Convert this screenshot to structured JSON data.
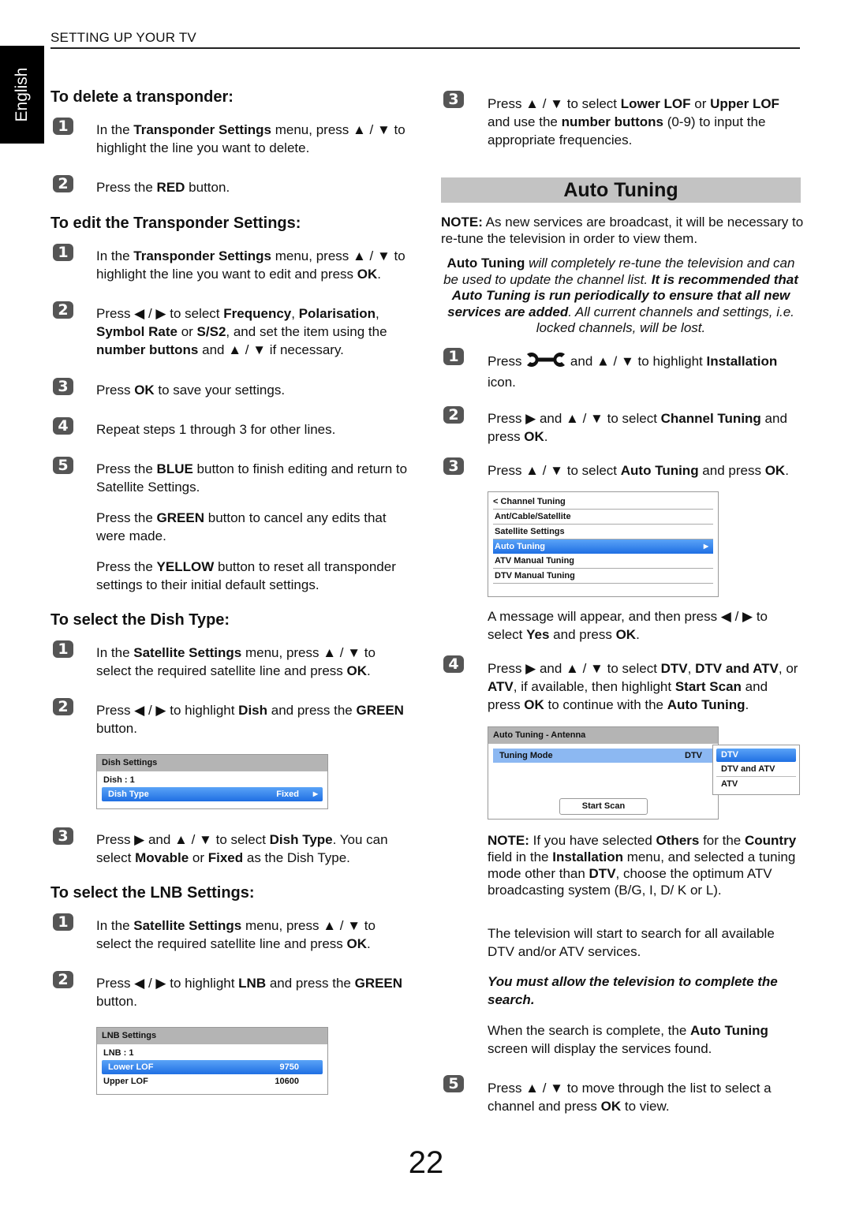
{
  "header": {
    "section": "SETTING UP YOUR TV",
    "language_tab": "English",
    "page_number": "22"
  },
  "left": {
    "delete": {
      "title": "To delete a transponder:",
      "steps": [
        {
          "n": "1",
          "pre": "In the ",
          "b1": "Transponder Settings",
          "mid": " menu, press ▲ / ▼ to highlight the line you want to delete."
        },
        {
          "n": "2",
          "pre": "Press the ",
          "b1": "RED",
          "mid": " button."
        }
      ]
    },
    "edit": {
      "title": "To edit the Transponder Settings:",
      "s1": {
        "n": "1",
        "a": "In the ",
        "b": "Transponder Settings",
        "c": " menu, press ▲ / ▼ to highlight the line you want to edit and press ",
        "d": "OK",
        "e": "."
      },
      "s2": {
        "n": "2",
        "a": "Press ◀ / ▶ to select ",
        "b": "Frequency",
        "c": ", ",
        "d": "Polarisation",
        "e": ", ",
        "f": "Symbol Rate",
        "g": " or ",
        "h": "S/S2",
        "i": ", and set the item using the ",
        "j": "number buttons",
        "k": " and ▲ / ▼ if necessary."
      },
      "s3": {
        "n": "3",
        "a": "Press ",
        "b": "OK",
        "c": " to save your settings."
      },
      "s4": {
        "n": "4",
        "a": "Repeat steps 1 through 3 for other lines."
      },
      "s5": {
        "n": "5",
        "a": "Press the ",
        "b": "BLUE",
        "c": " button to finish editing and return to Satellite Settings."
      },
      "p_green": {
        "a": "Press the ",
        "b": "GREEN",
        "c": " button to cancel any edits that were made."
      },
      "p_yellow": {
        "a": "Press the ",
        "b": "YELLOW",
        "c": " button to reset all transponder settings to their initial default settings."
      }
    },
    "dish": {
      "title": "To select the Dish Type:",
      "s1": {
        "n": "1",
        "a": "In the ",
        "b": "Satellite Settings",
        "c": " menu, press ▲ / ▼ to select the required satellite line and press ",
        "d": "OK",
        "e": "."
      },
      "s2": {
        "n": "2",
        "a": "Press ◀ / ▶ to highlight ",
        "b": "Dish",
        "c": " and press the ",
        "d": "GREEN",
        "e": " button."
      },
      "menu": {
        "title": "Dish Settings",
        "row1": "Dish : 1",
        "sel_label": "Dish Type",
        "sel_value": "Fixed",
        "arrow": "▶"
      },
      "s3": {
        "n": "3",
        "a": "Press ▶ and ▲ / ▼ to select ",
        "b": "Dish Type",
        "c": ". You can select ",
        "d": "Movable",
        "e": " or ",
        "f": "Fixed",
        "g": " as the Dish Type."
      }
    },
    "lnb": {
      "title": "To select the LNB Settings:",
      "s1": {
        "n": "1",
        "a": "In the ",
        "b": "Satellite Settings",
        "c": " menu, press ▲ / ▼ to select the required satellite line and press ",
        "d": "OK",
        "e": "."
      },
      "s2": {
        "n": "2",
        "a": "Press ◀ / ▶ to highlight ",
        "b": "LNB",
        "c": " and press the ",
        "d": "GREEN",
        "e": " button."
      },
      "menu": {
        "title": "LNB Settings",
        "row1": "LNB : 1",
        "sel_label": "Lower LOF",
        "sel_value": "9750",
        "row3_label": "Upper LOF",
        "row3_value": "10600"
      }
    }
  },
  "right": {
    "lnb_s3": {
      "n": "3",
      "a": "Press ▲ / ▼ to select ",
      "b": "Lower LOF",
      "c": " or ",
      "d": "Upper LOF",
      "e": " and use the ",
      "f": "number buttons",
      "g": " (0-9) to input the appropriate frequencies."
    },
    "auto_title": "Auto Tuning",
    "note1": {
      "b": "NOTE:",
      "a": " As new services are broadcast, it will be necessary to re-tune the television in order to view them."
    },
    "italic": {
      "b1": "Auto Tuning",
      "t1": " will completely re-tune the television and can be used to update the channel list. ",
      "b2": "It is recommended that Auto Tuning is run periodically to ensure that all new services are added",
      "t2": ". All current channels and settings, i.e. locked channels, will be lost."
    },
    "s1": {
      "n": "1",
      "a": "Press ",
      "b": " and ▲ / ▼ to highlight ",
      "c": "Installation",
      "d": " icon.",
      "icon": "wrench-icon"
    },
    "s2": {
      "n": "2",
      "a": "Press ▶ and ▲ / ▼ to select ",
      "b": "Channel Tuning",
      "c": " and press ",
      "d": "OK",
      "e": "."
    },
    "s3": {
      "n": "3",
      "a": "Press ▲ / ▼ to select ",
      "b": "Auto Tuning",
      "c": " and press ",
      "d": "OK",
      "e": "."
    },
    "channel_menu": {
      "back": "< Channel Tuning",
      "items": [
        "Ant/Cable/Satellite",
        "Satellite Settings",
        "Auto Tuning",
        "ATV Manual Tuning",
        "DTV Manual Tuning"
      ],
      "selected_index": 2,
      "arrow": "▶"
    },
    "msg": {
      "a": "A message will appear, and then press ◀ / ▶ to select ",
      "b": "Yes",
      "c": " and press ",
      "d": "OK",
      "e": "."
    },
    "s4": {
      "n": "4",
      "a": "Press ▶ and ▲ / ▼ to select ",
      "b": "DTV",
      "c": ", ",
      "d": "DTV and ATV",
      "e": ", or ",
      "f": "ATV",
      "g": ", if available, then highlight ",
      "h": "Start Scan",
      "i": " and press ",
      "j": "OK",
      "k": " to continue with the ",
      "l": "Auto Tuning",
      "m": "."
    },
    "auto_menu": {
      "title": "Auto Tuning - Antenna",
      "row_label": "Tuning Mode",
      "row_value": "DTV",
      "button": "Start Scan",
      "options": [
        "DTV",
        "DTV and ATV",
        "ATV"
      ],
      "selected_option": "DTV"
    },
    "note2": {
      "a": "NOTE:",
      "b": " If you have selected ",
      "c": "Others",
      "d": " for the ",
      "e": "Country",
      "f": " field in the ",
      "g": "Installation",
      "h": " menu, and selected a tuning mode other than ",
      "i": "DTV",
      "j": ", choose the optimum ATV broadcasting system (B/G, I, D/ K or L)."
    },
    "search_text": "The television will start to search for all available DTV and/or ATV services.",
    "must_allow": "You must allow the television to complete the search.",
    "complete": {
      "a": "When the search is complete, the ",
      "b": "Auto Tuning",
      "c": " screen will display the services found."
    },
    "s5": {
      "n": "5",
      "a": "Press ▲ / ▼ to move through the list to select a channel and press ",
      "b": "OK",
      "c": " to view."
    }
  }
}
